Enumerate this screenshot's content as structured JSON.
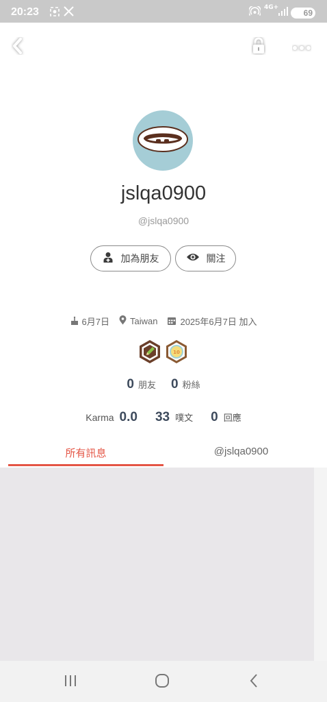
{
  "status_bar": {
    "time": "20:23",
    "network": "4G+",
    "battery": "69",
    "icons": [
      "screenshot-icon",
      "x-logo-icon",
      "hotspot-icon",
      "signal-icon"
    ]
  },
  "top_bar": {
    "back_icon": "chevron-left-icon",
    "lock_icon": "lock-icon",
    "more_icon": "more-dots-icon"
  },
  "profile": {
    "display_name": "jslqa0900",
    "handle": "@jslqa0900",
    "add_friend_label": "加為朋友",
    "follow_label": "關注",
    "birthday": "6月7日",
    "location": "Taiwan",
    "joined": "2025年6月7日 加入",
    "badges": [
      "pencil-badge",
      "number-badge"
    ],
    "badge_number": "10"
  },
  "stats": {
    "friends_count": "0",
    "friends_label": "朋友",
    "fans_count": "0",
    "fans_label": "粉絲"
  },
  "karma": {
    "label": "Karma",
    "value": "0.0",
    "plurks_count": "33",
    "plurks_label": "噗文",
    "responses_count": "0",
    "responses_label": "回應"
  },
  "tabs": {
    "all_messages": "所有訊息",
    "handle_tab": "@jslqa0900"
  },
  "colors": {
    "accent": "#e45545",
    "avatar_bg": "#a5cdd6",
    "feed_bg": "#e9e7ea",
    "stat_number": "#3d4a5c"
  }
}
